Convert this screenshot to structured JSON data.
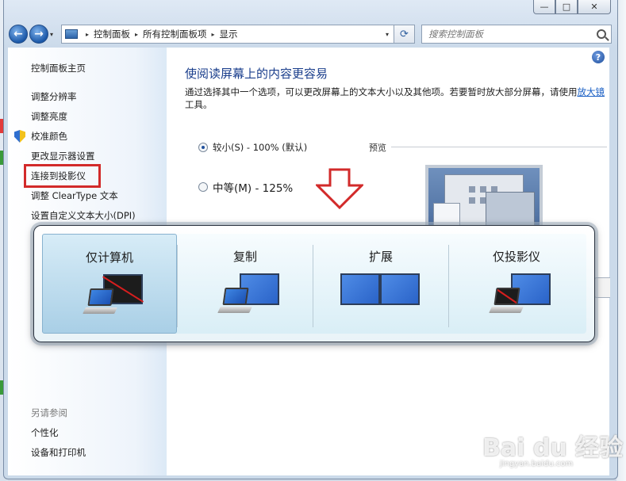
{
  "window": {
    "min_glyph": "—",
    "max_glyph": "□",
    "close_glyph": "✕"
  },
  "nav": {
    "back_glyph": "←",
    "forward_glyph": "→",
    "dropdown_glyph": "▾",
    "crumb_sep": "▸",
    "breadcrumbs": [
      "控制面板",
      "所有控制面板项",
      "显示"
    ],
    "address_dropdown_glyph": "▾",
    "refresh_glyph": "⟳",
    "search_placeholder": "搜索控制面板"
  },
  "sidebar": {
    "home": "控制面板主页",
    "links": [
      "调整分辨率",
      "调整亮度",
      "校准颜色",
      "更改显示器设置",
      "连接到投影仪",
      "调整 ClearType 文本",
      "设置自定义文本大小(DPI)"
    ],
    "see_also_title": "另请参阅",
    "see_also": [
      "个性化",
      "设备和打印机"
    ]
  },
  "main": {
    "help_glyph": "?",
    "title": "使阅读屏幕上的内容更容易",
    "desc_text": "通过选择其中一个选项，可以更改屏幕上的文本大小以及其他项。若要暂时放大部分屏幕，请使用",
    "desc_link": "放大镜",
    "desc_tail": "工具。",
    "option_small": "较小(S) - 100% (默认)",
    "option_medium": "中等(M) - 125%",
    "preview_label": "预览"
  },
  "projector_switch": {
    "options": [
      "仅计算机",
      "复制",
      "扩展",
      "仅投影仪"
    ],
    "selected": 0
  },
  "watermark": {
    "main": "Bai du 经验",
    "sub": "jingyan.baidu.com"
  },
  "colors": {
    "accent_title": "#1a3e8c",
    "highlight_red": "#d22a2a",
    "selected_tile": "#a9cfe6"
  }
}
